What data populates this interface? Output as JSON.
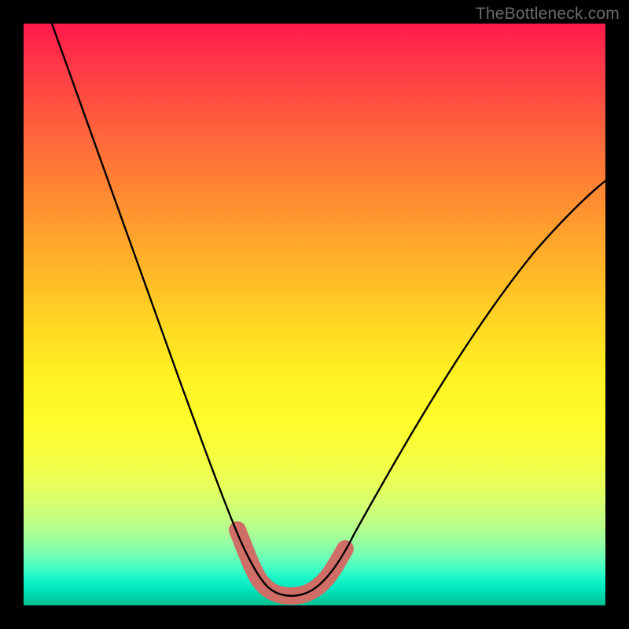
{
  "watermark": "TheBottleneck.com",
  "chart_data": {
    "type": "line",
    "title": "",
    "xlabel": "",
    "ylabel": "",
    "xlim": [
      0,
      100
    ],
    "ylim": [
      0,
      100
    ],
    "grid": false,
    "legend": false,
    "series": [
      {
        "name": "bottleneck-curve",
        "x": [
          5,
          10,
          15,
          20,
          25,
          30,
          35,
          38,
          40,
          42,
          44,
          46,
          48,
          50,
          52,
          55,
          60,
          65,
          70,
          75,
          80,
          85,
          90,
          95,
          100
        ],
        "y": [
          100,
          87,
          74,
          61,
          48,
          35,
          22,
          13,
          8,
          5,
          3,
          2,
          2,
          2,
          3,
          5,
          10,
          17,
          24,
          31,
          38,
          45,
          52,
          59,
          66
        ]
      }
    ],
    "annotations": [
      {
        "name": "highlighted-minimum",
        "type": "segment-highlight",
        "x_range": [
          38,
          55
        ],
        "color": "#cf6e66"
      }
    ],
    "background_gradient": {
      "top": "#ff1a4a",
      "middle": "#fff022",
      "bottom": "#00c090"
    },
    "watermark": "TheBottleneck.com"
  }
}
